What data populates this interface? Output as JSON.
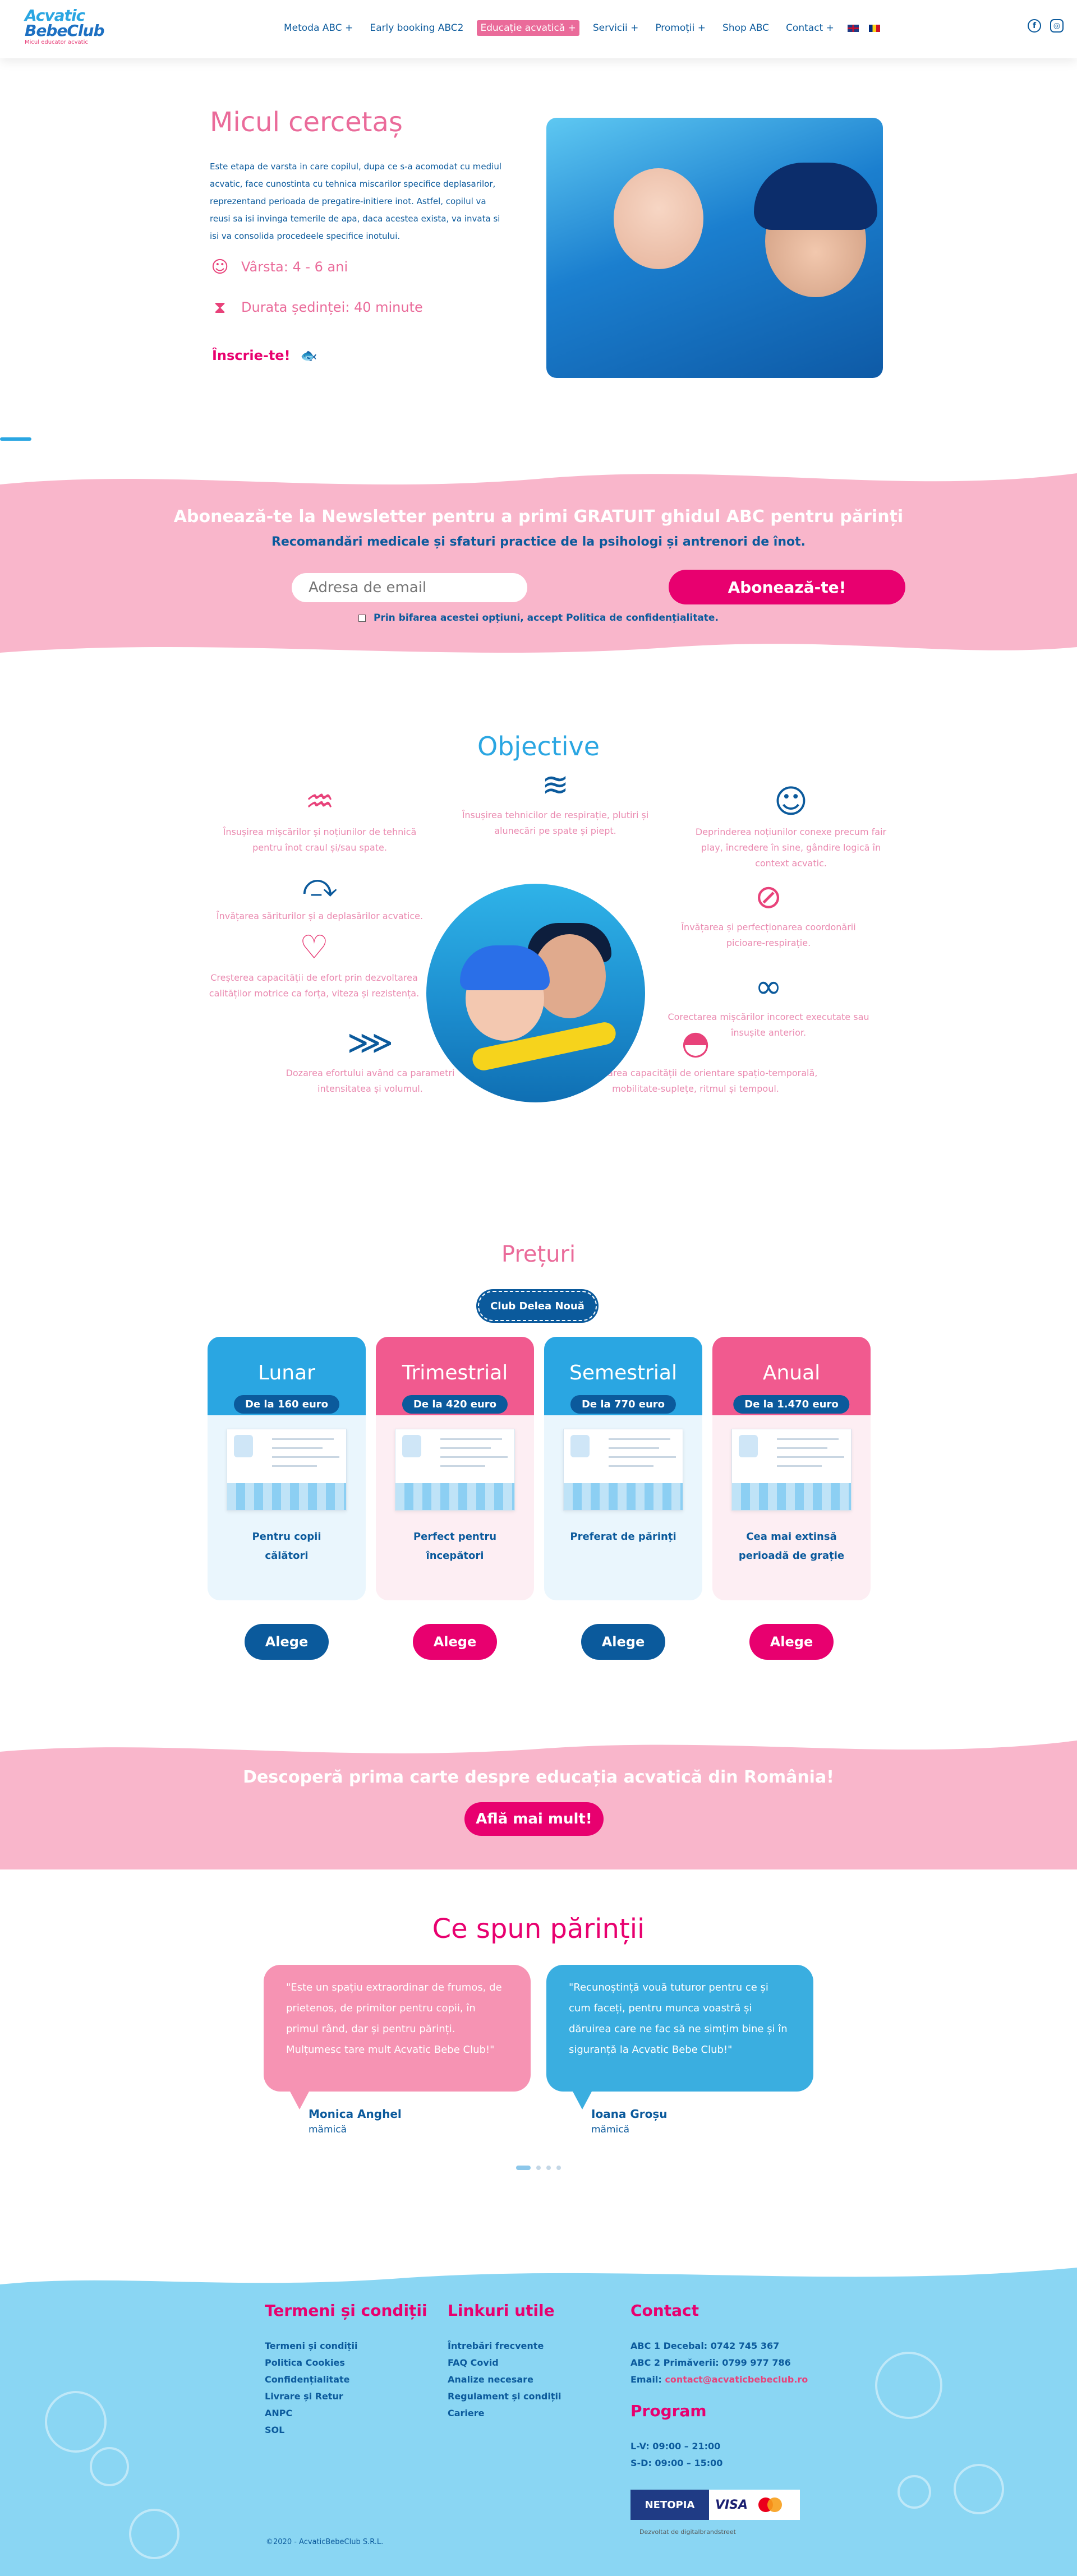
{
  "header": {
    "logo_line1": "Acvatic",
    "logo_line2": "BebeClub",
    "logo_tagline": "Micul educator acvatic",
    "nav": [
      {
        "label": "Metoda ABC +"
      },
      {
        "label": "Early booking ABC2"
      },
      {
        "label": "Educație acvatică +"
      },
      {
        "label": "Servicii +"
      },
      {
        "label": "Promoții +"
      },
      {
        "label": "Shop ABC"
      },
      {
        "label": "Contact +"
      }
    ],
    "social_fb": "f",
    "social_ig": "◎"
  },
  "hero": {
    "title": "Micul cercetaș",
    "description": "Este etapa de varsta in care copilul, dupa ce s-a acomodat cu mediul acvatic, face cunostinta cu tehnica miscarilor specifice deplasarilor, reprezentand perioada de pregatire-initiere inot. Astfel, copilul va reusi sa isi invinga temerile de apa, daca acestea exista, va invata si isi va consolida procedeele specifice inotului.",
    "age_label": "Vârsta: 4 - 6 ani",
    "duration_label": "Durata ședinței: 40 minute",
    "cta": "Înscrie-te!",
    "age_icon": "child-icon",
    "duration_icon": "hourglass-icon"
  },
  "newsletter": {
    "title": "Abonează-te la Newsletter pentru a primi GRATUIT ghidul ABC pentru părinți",
    "subtitle": "Recomandări medicale și sfaturi practice de la psihologi și antrenori de înot.",
    "email_placeholder": "Adresa de email",
    "button": "Abonează-te!",
    "consent": "Prin bifarea acestei opțiuni, accept Politica de confidențialitate."
  },
  "objectives": {
    "title": "Objective",
    "items": [
      {
        "text": "Însușirea mișcărilor și noțiunilor de tehnică pentru înot craul și/sau spate.",
        "icon": "pool-ladder-icon",
        "color": "pink"
      },
      {
        "text": "Însușirea tehnicilor de respirație, plutiri și alunecări pe spate și piept.",
        "icon": "swimmer-icon",
        "color": "blue"
      },
      {
        "text": "Deprinderea noțiunilor conexe precum fair play, încredere în sine, gândire logică în context acvatic.",
        "icon": "kid-icon",
        "color": "blue"
      },
      {
        "text": "Învățarea săriturilor și a deplasărilor acvatice.",
        "icon": "diver-icon",
        "color": "blue"
      },
      {
        "text": "Învățarea și perfecționarea coordonării picioare-respirație.",
        "icon": "snorkel-icon",
        "color": "pink"
      },
      {
        "text": "Creșterea capacității de efort prin dezvoltarea calităților motrice ca forța, viteza și rezistența.",
        "icon": "heart-rate-icon",
        "color": "pink"
      },
      {
        "text": "Corectarea mișcărilor incorect executate sau însușite anterior.",
        "icon": "goggles-icon",
        "color": "blue"
      },
      {
        "text": "Dozarea efortului având ca parametri intensitatea și volumul.",
        "icon": "lanes-icon",
        "color": "blue"
      },
      {
        "text": "Dezvoltarea capacității de orientare spațio-temporală, mobilitate-suplețe, ritmul și tempoul.",
        "icon": "swim-cap-icon",
        "color": "pink"
      }
    ]
  },
  "prices": {
    "title": "Prețuri",
    "club": "Club Delea Nouă",
    "plans": [
      {
        "name": "Lunar",
        "from": "De la 160 euro",
        "text": "Pentru copii călători",
        "button": "Alege",
        "accent": "#2aa6e2"
      },
      {
        "name": "Trimestrial",
        "from": "De la 420 euro",
        "text": "Perfect pentru începători",
        "button": "Alege",
        "accent": "#f15a8f"
      },
      {
        "name": "Semestrial",
        "from": "De la 770 euro",
        "text": "Preferat de părinți",
        "button": "Alege",
        "accent": "#2aa6e2"
      },
      {
        "name": "Anual",
        "from": "De la 1.470 euro",
        "text": "Cea mai extinsă perioadă de grație",
        "button": "Alege",
        "accent": "#f15a8f"
      }
    ]
  },
  "book": {
    "title": "Descoperă prima carte despre educația acvatică din România!",
    "button": "Află mai mult!"
  },
  "testimonials": {
    "title": "Ce spun părinții",
    "items": [
      {
        "quote": "\"Este un spațiu extraordinar de frumos, de prietenos, de primitor pentru copii, în primul rând, dar și pentru părinți. Mulțumesc tare mult Acvatic Bebe Club!\"",
        "name": "Monica Anghel",
        "role": "mămică"
      },
      {
        "quote": "\"Recunoștință vouă tuturor pentru ce și cum faceți, pentru munca voastră și dăruirea care ne fac să ne simțim bine și în siguranță la Acvatic Bebe Club!\"",
        "name": "Ioana Groșu",
        "role": "mămică"
      }
    ]
  },
  "footer": {
    "terms": {
      "title": "Termeni și condiții",
      "links": [
        "Termeni și condiții",
        "Politica Cookies",
        "Confidențialitate",
        "Livrare și Retur",
        "ANPC",
        "SOL"
      ]
    },
    "useful": {
      "title": "Linkuri utile",
      "links": [
        "Întrebări frecvente",
        "FAQ Covid",
        "Analize necesare",
        "Regulament și condiții",
        "Cariere"
      ]
    },
    "contact": {
      "title": "Contact",
      "lines": [
        "ABC 1 Decebal: 0742 745 367",
        "ABC 2 Primăverii: 0799 977 786"
      ],
      "email_label": "Email:",
      "email": "contact@acvaticbebeclub.ro"
    },
    "program": {
      "title": "Program",
      "lines": [
        "L-V: 09:00 – 21:00",
        "S-D: 09:00 – 15:00"
      ]
    },
    "payments": {
      "netopia": "NETOPIA",
      "visa": "VISA"
    },
    "copyright": "©2020 - AcvaticBebeClub S.R.L.",
    "developer": "Dezvoltat de digitalbrandstreet"
  }
}
